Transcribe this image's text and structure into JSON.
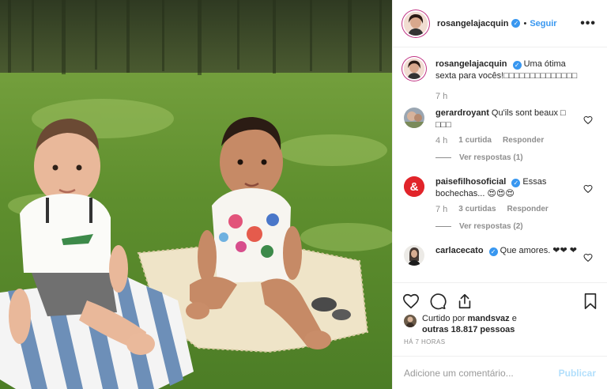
{
  "post": {
    "author": "rosangelajacquin",
    "follow_label": "Seguir",
    "more_label": "•••",
    "caption": "Uma ótima sexta para vocês!",
    "caption_glyphs": "□□□□□□□□□□□□□□",
    "caption_time": "7 h"
  },
  "comments": [
    {
      "user": "gerardroyant",
      "text": "Qu'ils sont beaux □ □□□",
      "time": "4 h",
      "likes": "1 curtida",
      "reply_label": "Responder",
      "view_replies": "Ver respostas (1)"
    },
    {
      "user": "paisefilhosoficial",
      "text": "Essas bochechas... 😍😍😍",
      "time": "7 h",
      "likes": "3 curtidas",
      "reply_label": "Responder",
      "view_replies": "Ver respostas (2)"
    },
    {
      "user": "carlacecato",
      "text": "Que amores. ❤❤ ❤"
    }
  ],
  "likes": {
    "prefix": "Curtido por",
    "user": "mandsvaz",
    "middle": "e",
    "others": "outras 18.817 pessoas"
  },
  "timestamp": "HÁ 7 HORAS",
  "comment_box": {
    "placeholder": "Adicione um comentário...",
    "publish_label": "Publicar"
  },
  "colors": {
    "link": "#3897f0",
    "publish_disabled": "#b2dffc",
    "muted": "#8e8e8e"
  },
  "icons": [
    "heart-icon",
    "comment-icon",
    "share-icon",
    "bookmark-icon",
    "verified-badge-icon"
  ]
}
